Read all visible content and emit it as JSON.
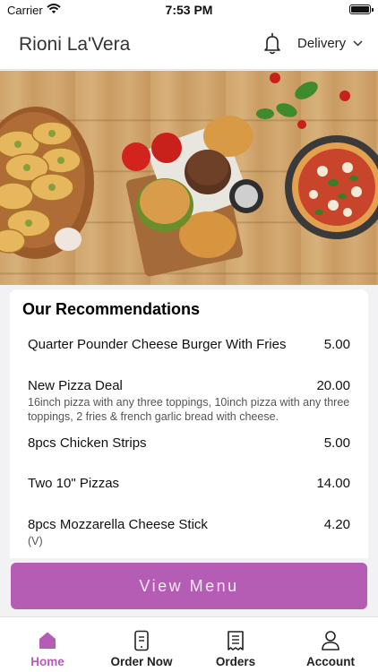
{
  "status_bar": {
    "carrier": "Carrier",
    "time": "7:53 PM"
  },
  "header": {
    "restaurant_name": "Rioni La'Vera",
    "delivery_label": "Delivery"
  },
  "recommendations": {
    "title": "Our Recommendations",
    "items": [
      {
        "name": "Quarter Pounder Cheese Burger With Fries",
        "price": "5.00",
        "description": ""
      },
      {
        "name": "New Pizza Deal",
        "price": "20.00",
        "description": "16inch pizza with any three toppings, 10inch pizza with any three toppings, 2 fries & french garlic bread with cheese."
      },
      {
        "name": "8pcs Chicken Strips",
        "price": "5.00",
        "description": ""
      },
      {
        "name": "Two 10\" Pizzas",
        "price": "14.00",
        "description": ""
      },
      {
        "name": "8pcs Mozzarella Cheese Stick",
        "price": "4.20",
        "description": "(V)"
      }
    ]
  },
  "view_menu_label": "View Menu",
  "tabs": [
    {
      "label": "Home",
      "icon": "home-icon",
      "active": true
    },
    {
      "label": "Order Now",
      "icon": "phone-order-icon",
      "active": false
    },
    {
      "label": "Orders",
      "icon": "receipt-icon",
      "active": false
    },
    {
      "label": "Account",
      "icon": "person-icon",
      "active": false
    }
  ],
  "colors": {
    "accent": "#b55db4",
    "background": "#f2f2f4"
  }
}
